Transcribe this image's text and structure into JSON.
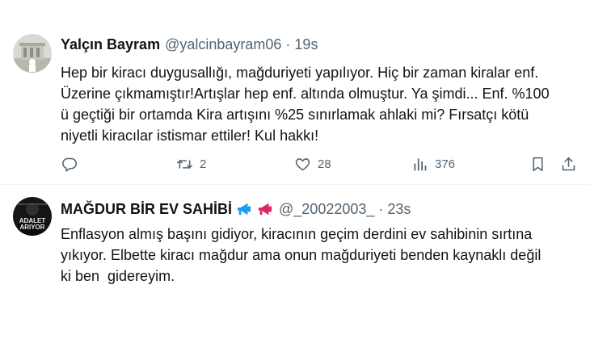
{
  "tweets": [
    {
      "name": "Yalçın Bayram",
      "handle": "@yalcinbayram06",
      "separator": "·",
      "time": "19s",
      "lines": [
        "Hep bir kiracı duygusallığı, mağduriyeti yapılıyor. Hiç bir zaman kiralar enf.",
        "Üzerine çıkmamıştır!Artışlar hep enf. altında olmuştur. Ya şimdi... Enf. %100",
        "ü geçtiği bir ortamda Kira artışını %25 sınırlamak ahlaki mi? Fırsatçı kötü",
        "niyetli kiracılar istismar ettiler! Kul hakkı!"
      ],
      "actions": {
        "reply_icon": "reply-icon",
        "retweet_icon": "retweet-icon",
        "retweets": "2",
        "like_icon": "heart-icon",
        "likes": "28",
        "views_icon": "analytics-icon",
        "views": "376",
        "bookmark_icon": "bookmark-icon",
        "share_icon": "share-icon"
      }
    },
    {
      "name": "MAĞDUR BİR EV SAHİBİ",
      "name_emojis": [
        "megaphone-icon",
        "megaphone-icon"
      ],
      "handle": "@_20022003_",
      "separator": "·",
      "time": "23s",
      "avatar_text": [
        "ADALET",
        "ARIYOR"
      ],
      "lines": [
        "Enflasyon almış başını gidiyor, kiracının geçim derdini ev sahibinin sırtına",
        "yıkıyor. Elbette kiracı mağdur ama onun mağduriyeti benden kaynaklı değil",
        "ki ben  gidereyim."
      ]
    }
  ],
  "colors": {
    "text": "#0f1419",
    "secondary": "#536471",
    "divider": "#eff3f4",
    "megaphone_blue": "#1d9bf0",
    "megaphone_red": "#e0245e"
  }
}
